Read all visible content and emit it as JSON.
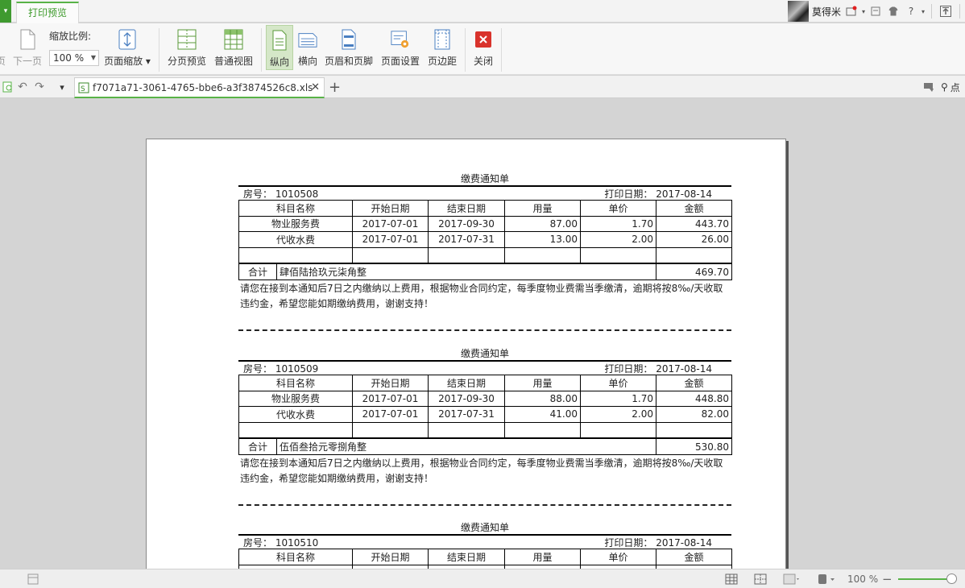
{
  "app": {
    "menu_glyph": "▾",
    "tab_title": "打印预览",
    "user_name": "莫得米",
    "help_label": "?",
    "accent_color": "#58b347"
  },
  "ribbon": {
    "prev_page": "页",
    "next_page": "下一页",
    "zoom_label": "缩放比例:",
    "zoom_value": "100 %",
    "page_zoom": "页面缩放",
    "page_break_preview": "分页预览",
    "normal_view": "普通视图",
    "portrait": "纵向",
    "landscape": "横向",
    "header_footer": "页眉和页脚",
    "page_setup": "页面设置",
    "margins": "页边距",
    "close": "关闭"
  },
  "docbar": {
    "filename": "f7071a71-3061-4765-bbe6-a3f3874526c8.xls",
    "search_label": "点"
  },
  "document": {
    "notices": [
      {
        "title": "缴费通知单",
        "room_label": "房号：",
        "room": "1010508",
        "print_label": "打印日期：",
        "print_date": "2017-08-14",
        "columns": [
          "科目名称",
          "开始日期",
          "结束日期",
          "用量",
          "单价",
          "金额"
        ],
        "rows": [
          [
            "物业服务费",
            "2017-07-01",
            "2017-09-30",
            "87.00",
            "1.70",
            "443.70"
          ],
          [
            "代收水费",
            "2017-07-01",
            "2017-07-31",
            "13.00",
            "2.00",
            "26.00"
          ],
          [
            "",
            "",
            "",
            "",
            "",
            ""
          ]
        ],
        "total_label": "合计",
        "total_words": "肆佰陆拾玖元柒角整",
        "total": "469.70",
        "note": "请您在接到本通知后7日之内缴纳以上费用，根据物业合同约定，每季度物业费需当季缴清，逾期将按8‰/天收取违约金，希望您能如期缴纳费用，谢谢支持！"
      },
      {
        "title": "缴费通知单",
        "room_label": "房号：",
        "room": "1010509",
        "print_label": "打印日期：",
        "print_date": "2017-08-14",
        "columns": [
          "科目名称",
          "开始日期",
          "结束日期",
          "用量",
          "单价",
          "金额"
        ],
        "rows": [
          [
            "物业服务费",
            "2017-07-01",
            "2017-09-30",
            "88.00",
            "1.70",
            "448.80"
          ],
          [
            "代收水费",
            "2017-07-01",
            "2017-07-31",
            "41.00",
            "2.00",
            "82.00"
          ],
          [
            "",
            "",
            "",
            "",
            "",
            ""
          ]
        ],
        "total_label": "合计",
        "total_words": "伍佰叁拾元零捌角整",
        "total": "530.80",
        "note": "请您在接到本通知后7日之内缴纳以上费用，根据物业合同约定，每季度物业费需当季缴清，逾期将按8‰/天收取违约金，希望您能如期缴纳费用，谢谢支持！"
      },
      {
        "title": "缴费通知单",
        "room_label": "房号：",
        "room": "1010510",
        "print_label": "打印日期：",
        "print_date": "2017-08-14",
        "columns": [
          "科目名称",
          "开始日期",
          "结束日期",
          "用量",
          "单价",
          "金额"
        ]
      }
    ]
  },
  "statusbar": {
    "zoom_value": "100 %",
    "zoom_level_percent": 100
  }
}
